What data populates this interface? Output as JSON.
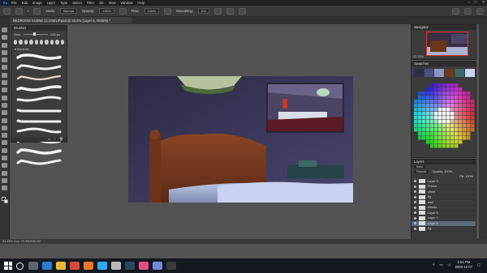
{
  "menubar": {
    "items": [
      "File",
      "Edit",
      "Image",
      "Layer",
      "Type",
      "Select",
      "Filter",
      "3D",
      "View",
      "Window",
      "Help"
    ],
    "window_controls": [
      "–",
      "□",
      "✕"
    ]
  },
  "options": {
    "mode_label": "Mode:",
    "mode_value": "Normal",
    "opacity_label": "Opacity:",
    "opacity_value": "100%",
    "flow_label": "Flow:",
    "flow_value": "100%",
    "smoothing_label": "Smoothing:",
    "smoothing_value": "0%"
  },
  "document": {
    "tab_title": "BEDROOM SCENE CLOSEUP.psd @ 33.3% (Layer 5, RGB/8) *",
    "status": "33.33%    Doc: 24.9M/268.4M"
  },
  "brushes": {
    "title": "Brushes",
    "size_label": "Size:",
    "size_value": "125 px",
    "folder_label": "▾ Brushes",
    "tip_count": 10,
    "stroke_count": 11
  },
  "navigator": {
    "title": "Navigator",
    "zoom": "33.33%"
  },
  "swatches": {
    "title": "Swatches"
  },
  "layers": {
    "title": "Layers",
    "search_placeholder": "Kind",
    "blend": "Normal",
    "opacity": "Opacity: 100%",
    "fill": "Fill: 100%",
    "rows": [
      {
        "name": "Layer 9",
        "sel": false
      },
      {
        "name": "Frame",
        "sel": false
      },
      {
        "name": "sheet",
        "sel": false
      },
      {
        "name": "bg",
        "sel": false
      },
      {
        "name": "wall",
        "sel": false
      },
      {
        "name": "blends",
        "sel": false
      },
      {
        "name": "Layer 8",
        "sel": false
      },
      {
        "name": "Layer 7",
        "sel": false
      },
      {
        "name": "Layer 5",
        "sel": true
      },
      {
        "name": "bg",
        "sel": false
      }
    ]
  },
  "taskbar": {
    "time": "2:51 PM",
    "date": "2020-12-07",
    "apps": [
      {
        "name": "task-view-app",
        "color": "#5d6470"
      },
      {
        "name": "edge-app",
        "color": "#2b7bd4"
      },
      {
        "name": "explorer-app",
        "color": "#e8b83a"
      },
      {
        "name": "chrome-app",
        "color": "#d64a3a"
      },
      {
        "name": "firefox-app",
        "color": "#e8772e"
      },
      {
        "name": "photoshop-app",
        "color": "#31a8ff"
      },
      {
        "name": "clip-app",
        "color": "#b8b8b8"
      },
      {
        "name": "steam-app",
        "color": "#2a475e"
      },
      {
        "name": "music-app",
        "color": "#e34b8a"
      },
      {
        "name": "discord-app",
        "color": "#7289da"
      },
      {
        "name": "obs-app",
        "color": "#3b3b3b"
      }
    ]
  },
  "colors": {
    "accent": "#31a8ff",
    "selected_layer": "#5d6a7b"
  }
}
